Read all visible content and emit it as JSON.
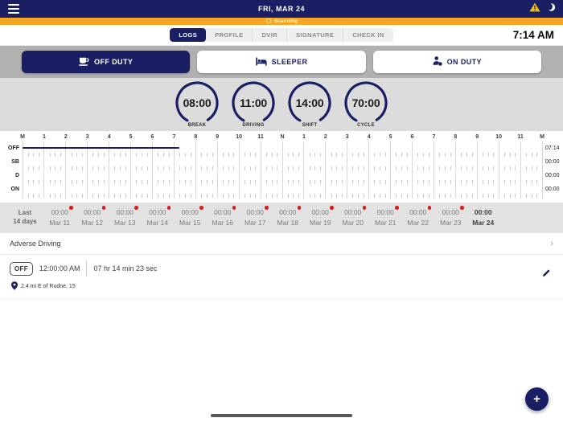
{
  "colors": {
    "navy": "#1a1f63",
    "orange": "#f6a624",
    "warning_yellow": "#f4c20d",
    "red_dot": "#d41f1f"
  },
  "top_bar": {
    "title": "FRI, MAR 24",
    "menu_icon": "hamburger-icon",
    "warning_icon": "warning-triangle-icon",
    "night_icon": "moon-icon"
  },
  "scan_bar": {
    "label": "Scanning",
    "icon": "spinner-icon"
  },
  "tab_bar": {
    "tabs": [
      {
        "label": "LOGS",
        "active": true
      },
      {
        "label": "PROFILE",
        "active": false
      },
      {
        "label": "DVIR",
        "active": false
      },
      {
        "label": "SIGNATURE",
        "active": false
      },
      {
        "label": "CHECK IN",
        "active": false
      }
    ],
    "clock": "7:14 AM"
  },
  "duty_buttons": [
    {
      "label": "OFF DUTY",
      "icon": "coffee-cup-icon",
      "active": true
    },
    {
      "label": "SLEEPER",
      "icon": "bed-icon",
      "active": false
    },
    {
      "label": "ON DUTY",
      "icon": "person-icon",
      "active": false
    }
  ],
  "gauges": [
    {
      "value": "08:00",
      "label": "BREAK"
    },
    {
      "value": "11:00",
      "label": "DRIVING"
    },
    {
      "value": "14:00",
      "label": "SHIFT"
    },
    {
      "value": "70:00",
      "label": "CYCLE"
    }
  ],
  "graph": {
    "hour_labels": [
      "M",
      "1",
      "2",
      "3",
      "4",
      "5",
      "6",
      "7",
      "8",
      "9",
      "10",
      "11",
      "N",
      "1",
      "2",
      "3",
      "4",
      "5",
      "6",
      "7",
      "8",
      "9",
      "10",
      "11",
      "M"
    ],
    "rows": [
      {
        "label": "OFF",
        "total": "07:14"
      },
      {
        "label": "SB",
        "total": "00:00"
      },
      {
        "label": "D",
        "total": "00:00"
      },
      {
        "label": "ON",
        "total": "00:00"
      }
    ],
    "segments": [
      {
        "row_index": 0,
        "start_hour": 0,
        "end_hour": 7.233
      }
    ]
  },
  "days": {
    "header_line1": "Last",
    "header_line2": "14 days",
    "items": [
      {
        "time": "00:00",
        "date": "Mar 11",
        "alert": true,
        "active": false
      },
      {
        "time": "00:00",
        "date": "Mar 12",
        "alert": true,
        "active": false
      },
      {
        "time": "00:00",
        "date": "Mar 13",
        "alert": true,
        "active": false
      },
      {
        "time": "00:00",
        "date": "Mar 14",
        "alert": true,
        "active": false
      },
      {
        "time": "00:00",
        "date": "Mar 15",
        "alert": true,
        "active": false
      },
      {
        "time": "00:00",
        "date": "Mar 16",
        "alert": true,
        "active": false
      },
      {
        "time": "00:00",
        "date": "Mar 17",
        "alert": true,
        "active": false
      },
      {
        "time": "00:00",
        "date": "Mar 18",
        "alert": true,
        "active": false
      },
      {
        "time": "00:00",
        "date": "Mar 19",
        "alert": true,
        "active": false
      },
      {
        "time": "00:00",
        "date": "Mar 20",
        "alert": true,
        "active": false
      },
      {
        "time": "00:00",
        "date": "Mar 21",
        "alert": true,
        "active": false
      },
      {
        "time": "00:00",
        "date": "Mar 22",
        "alert": true,
        "active": false
      },
      {
        "time": "00:00",
        "date": "Mar 23",
        "alert": true,
        "active": false
      },
      {
        "time": "00:00",
        "date": "Mar 24",
        "alert": false,
        "active": true
      }
    ]
  },
  "adverse": {
    "label": "Adverse Driving",
    "chevron": "›"
  },
  "log_entries": [
    {
      "status": "OFF",
      "start_time": "12:00:00 AM",
      "duration": "07 hr 14 min 23 sec",
      "location": "2.4 mi E of Rudne, 15",
      "edit_icon": "pencil-icon",
      "location_icon": "map-pin-icon"
    }
  ],
  "fab": {
    "label": "+",
    "icon": "plus-icon"
  }
}
